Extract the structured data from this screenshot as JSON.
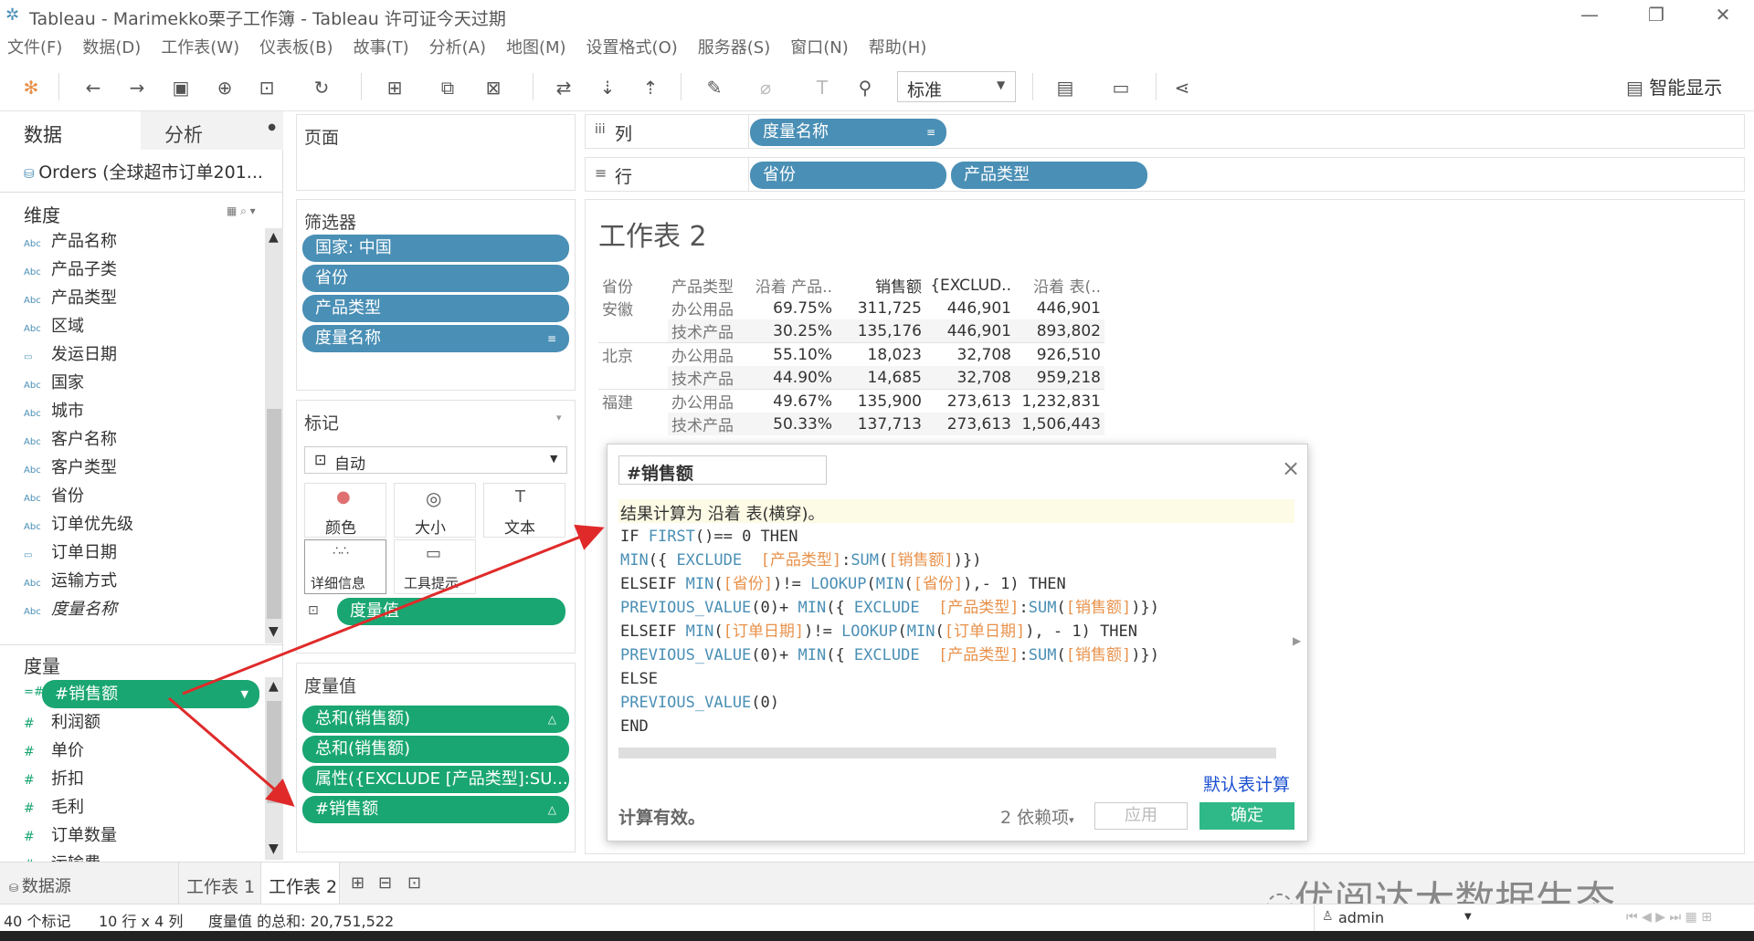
{
  "window": {
    "title": "Tableau - Marimekko栗子工作簿 - Tableau 许可证今天过期",
    "minimize": "—",
    "restore": "❐",
    "close": "✕"
  },
  "menu": [
    "文件(F)",
    "数据(D)",
    "工作表(W)",
    "仪表板(B)",
    "故事(T)",
    "分析(A)",
    "地图(M)",
    "设置格式(O)",
    "服务器(S)",
    "窗口(N)",
    "帮助(H)"
  ],
  "toolbar": {
    "fit_select": "标准",
    "smart_display": "智能显示"
  },
  "left": {
    "tab_data": "数据",
    "tab_analysis": "分析",
    "datasource": "Orders (全球超市订单201...",
    "dimensions_title": "维度",
    "dimensions": [
      {
        "icon": "Abc",
        "label": "产品名称"
      },
      {
        "icon": "Abc",
        "label": "产品子类"
      },
      {
        "icon": "Abc",
        "label": "产品类型"
      },
      {
        "icon": "Abc",
        "label": "区域"
      },
      {
        "icon": "▭",
        "label": "发运日期"
      },
      {
        "icon": "Abc",
        "label": "国家"
      },
      {
        "icon": "Abc",
        "label": "城市"
      },
      {
        "icon": "Abc",
        "label": "客户名称"
      },
      {
        "icon": "Abc",
        "label": "客户类型"
      },
      {
        "icon": "Abc",
        "label": "省份"
      },
      {
        "icon": "Abc",
        "label": "订单优先级"
      },
      {
        "icon": "▭",
        "label": "订单日期"
      },
      {
        "icon": "Abc",
        "label": "运输方式"
      },
      {
        "icon": "Abc",
        "label": "度量名称"
      }
    ],
    "measures_title": "度量",
    "measure_selected": "#销售额",
    "measures": [
      {
        "icon": "#",
        "label": "利润额"
      },
      {
        "icon": "#",
        "label": "单价"
      },
      {
        "icon": "#",
        "label": "折扣"
      },
      {
        "icon": "#",
        "label": "毛利"
      },
      {
        "icon": "#",
        "label": "订单数量"
      },
      {
        "icon": "#",
        "label": "运输费"
      }
    ]
  },
  "pages": {
    "title": "页面"
  },
  "filters": {
    "title": "筛选器",
    "items": [
      "国家: 中国",
      "省份",
      "产品类型",
      "度量名称"
    ]
  },
  "marks": {
    "title": "标记",
    "type": "自动",
    "cards": [
      "颜色",
      "大小",
      "文本",
      "详细信息",
      "工具提示"
    ],
    "pill": "度量值"
  },
  "measure_values": {
    "title": "度量值",
    "items": [
      "总和(销售额)",
      "总和(销售额)",
      "属性({EXCLUDE [产品类型]:SU...",
      "#销售额"
    ]
  },
  "shelves": {
    "columns_label": "列",
    "rows_label": "行",
    "columns": [
      "度量名称"
    ],
    "rows": [
      "省份",
      "产品类型"
    ]
  },
  "view": {
    "title": "工作表 2",
    "headers": [
      "省份",
      "产品类型",
      "沿着 产品..",
      "销售额",
      "{EXCLUD..",
      "沿着 表(.."
    ],
    "rows": [
      [
        "安徽",
        "办公用品",
        "69.75%",
        "311,725",
        "446,901",
        "446,901"
      ],
      [
        "",
        "技术产品",
        "30.25%",
        "135,176",
        "446,901",
        "893,802"
      ],
      [
        "北京",
        "办公用品",
        "55.10%",
        "18,023",
        "32,708",
        "926,510"
      ],
      [
        "",
        "技术产品",
        "44.90%",
        "14,685",
        "32,708",
        "959,218"
      ],
      [
        "福建",
        "办公用品",
        "49.67%",
        "135,900",
        "273,613",
        "1,232,831"
      ],
      [
        "",
        "技术产品",
        "50.33%",
        "137,713",
        "273,613",
        "1,506,443"
      ]
    ]
  },
  "dialog": {
    "name": "#销售额",
    "description": "结果计算为 沿着 表(横穿)。",
    "default_table_calc": "默认表计算",
    "status": "计算有效。",
    "deps": "2 依赖项",
    "apply": "应用",
    "ok": "确定",
    "close": "×"
  },
  "bottom": {
    "datasource_tab": "数据源",
    "sheets": [
      "工作表 1",
      "工作表 2"
    ]
  },
  "status": {
    "marks": "40 个标记",
    "dims": "10 行 x 4 列",
    "sum": "度量值 的总和: 20,751,522",
    "user": "admin"
  },
  "watermark": "优阅达大数据生态"
}
